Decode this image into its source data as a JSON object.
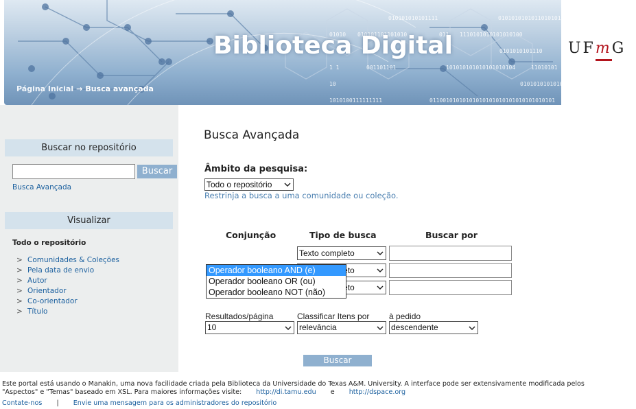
{
  "header": {
    "title": "Biblioteca Digital",
    "breadcrumb": {
      "home": "Página Inicial",
      "arrow": "→",
      "current": "Busca avançada"
    },
    "logo": {
      "u": "U",
      "f": "F",
      "m": "m",
      "g": "G"
    },
    "binary": [
      "010101010101111",
      "0101010101011010101010",
      "01010",
      "011",
      "1110101010101010100",
      "010101101101010",
      "0101010101110",
      "1 1",
      "001101101",
      "101010101010101010104",
      "11010101",
      "10",
      "0101010101010",
      "1010100111111111",
      "01100101010101010101010101010101010101"
    ]
  },
  "sidebar": {
    "search_heading": "Buscar no repositório",
    "search_input_value": "",
    "search_button": "Buscar",
    "advanced_link": "Busca Avançada",
    "browse_heading": "Visualizar",
    "browse_subheading": "Todo o repositório",
    "browse_marker": ">",
    "browse_items": [
      "Comunidades & Coleções",
      "Pela data de envio",
      "Autor",
      "Orientador",
      "Co-orientador",
      "Título"
    ]
  },
  "main": {
    "title": "Busca Avançada",
    "scope_label": "Âmbito da pesquisa:",
    "scope_value": "Todo o repositório",
    "scope_hint": "Restrinja a busca a uma comunidade ou coleção.",
    "col_conjunction": "Conjunção",
    "col_type": "Tipo de busca",
    "col_query": "Buscar por",
    "rows": [
      {
        "type": "Texto completo",
        "query": ""
      },
      {
        "type": "Texto completo",
        "query": ""
      },
      {
        "type": "Texto completo",
        "query": ""
      }
    ],
    "type_partial": "leto",
    "conjunction_options": [
      "Operador booleano AND (e)",
      "Operador booleano OR (ou)",
      "Operador booleano NOT (não)"
    ],
    "conjunction_selected_index": 0,
    "results_label": "Resultados/página",
    "results_value": "10",
    "sort_label": "Classificar Itens por",
    "sort_value": "relevância",
    "order_label": "à pedido",
    "order_value": "descendente",
    "submit": "Buscar"
  },
  "footer": {
    "line1": "Este portal está usando o Manakin, uma nova facilidade criada pela Biblioteca da Universidade do Texas A&M. University. A interface pode ser extensivamente modificada pelos",
    "line2_pre": "\"Aspectos\" e \"Temas\" baseado em XSL. Para maiores informações visite:",
    "link1": "http://di.tamu.edu",
    "and": "e",
    "link2": "http://dspace.org",
    "contact": "Contate-nos",
    "sep": "|",
    "admin_msg": "Envie uma mensagem para os administradores do repositório"
  },
  "colors": {
    "accent": "#8fb0cf",
    "sidebar_bg": "#eceeee",
    "sidebar_heading_bg": "#d4e2ec",
    "link": "#1a5f9e",
    "selected_option": "#3399ff",
    "ufmg_red": "#b3141d"
  }
}
